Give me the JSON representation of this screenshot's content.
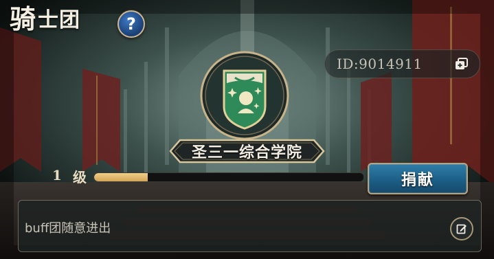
{
  "title": {
    "first_char": "骑",
    "rest": "士团"
  },
  "help_button": {
    "label": "?"
  },
  "guild": {
    "id_text": "ID:9014911",
    "name": "圣三一综合学院",
    "level_number": "1",
    "level_word": "级",
    "progress": 0.2,
    "notice": "buff团随意进出"
  },
  "buttons": {
    "donate": "捐献"
  },
  "icons": {
    "copy": "copy-icon",
    "edit": "edit-icon",
    "emblem": "shield-emblem-icon"
  },
  "colors": {
    "progress_fill": "#d9ae62",
    "button_blue": "#1f6a95",
    "emblem_green": "#2f8a5a",
    "gold_border": "#c8b48a"
  }
}
